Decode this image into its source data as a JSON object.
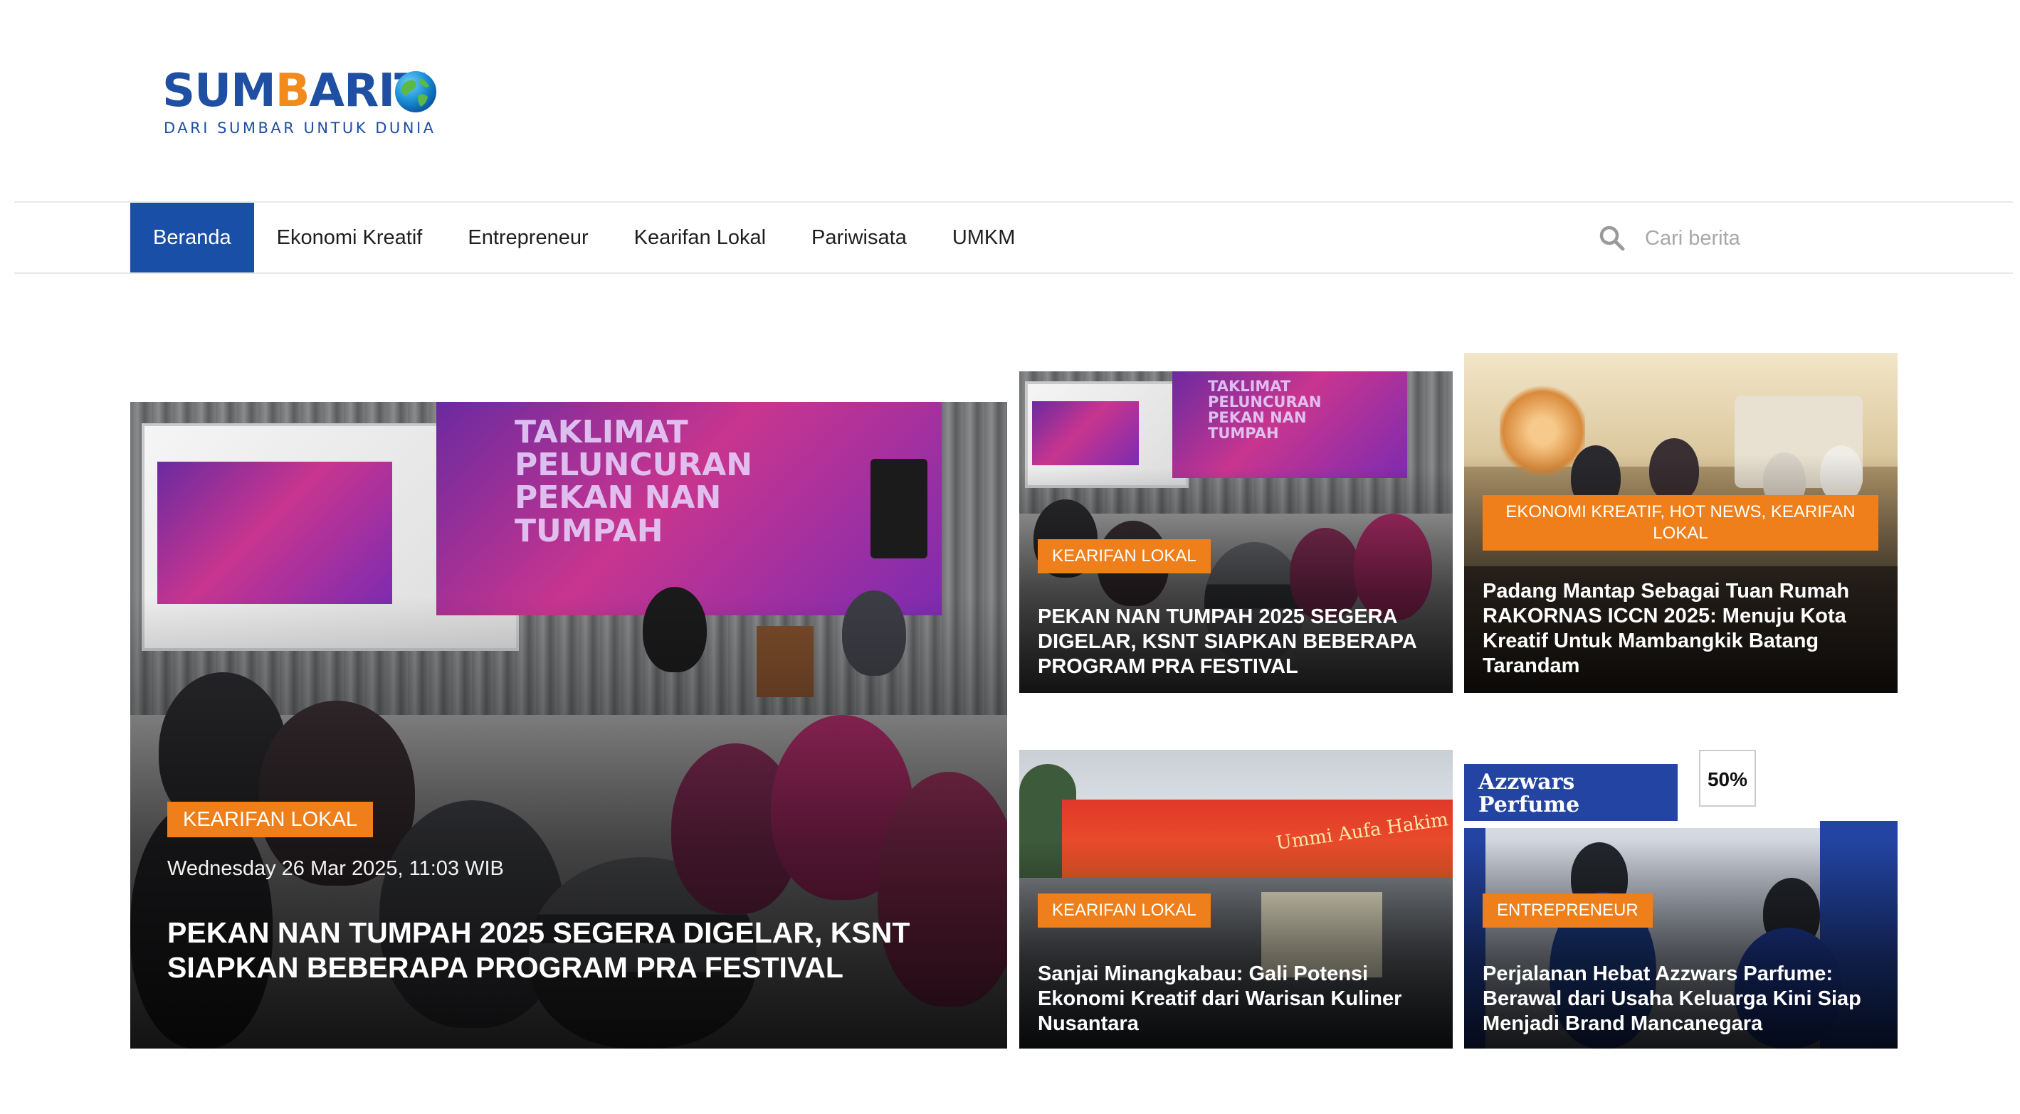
{
  "site": {
    "logo_word_part1": "SUM",
    "logo_word_part2": "B",
    "logo_word_part3": "ARIT",
    "tagline": "DARI SUMBAR UNTUK DUNIA"
  },
  "nav": {
    "items": [
      {
        "label": "Beranda",
        "active": true
      },
      {
        "label": "Ekonomi Kreatif",
        "active": false
      },
      {
        "label": "Entrepreneur",
        "active": false
      },
      {
        "label": "Kearifan Lokal",
        "active": false
      },
      {
        "label": "Pariwisata",
        "active": false
      },
      {
        "label": "UMKM",
        "active": false
      }
    ],
    "search_placeholder": "Cari berita"
  },
  "featured": {
    "category": "KEARIFAN LOKAL",
    "date": "Wednesday 26 Mar 2025, 11:03 WIB",
    "title": "PEKAN NAN TUMPAH 2025 SEGERA DIGELAR, KSNT SIAPKAN BEBERAPA PROGRAM PRA FESTIVAL",
    "image_banner_text": "TAKLIMAT PELUNCURAN PEKAN NAN TUMPAH"
  },
  "cards": [
    {
      "category": "KEARIFAN LOKAL",
      "title": "PEKAN NAN TUMPAH 2025 SEGERA DIGELAR, KSNT SIAPKAN BEBERAPA PROGRAM PRA FESTIVAL",
      "image_banner_text": "TAKLIMAT PELUNCURAN PEKAN NAN TUMPAH"
    },
    {
      "category": "EKONOMI KREATIF, HOT NEWS, KEARIFAN LOKAL",
      "title": "Padang Mantap Sebagai Tuan Rumah RAKORNAS ICCN 2025: Menuju Kota Kreatif Untuk Mambangkik Batang Tarandam"
    },
    {
      "category": "KEARIFAN LOKAL",
      "title": "Sanjai Minangkabau: Gali Potensi Ekonomi Kreatif dari Warisan Kuliner Nusantara",
      "image_sign_text": "Ummi Aufa Hakim"
    },
    {
      "category": "ENTREPRENEUR",
      "title": "Perjalanan Hebat Azzwars Parfume: Berawal dari Usaha Keluarga Kini Siap Menjadi Brand Mancanegara",
      "image_sign_text": "Azzwars Perfume",
      "image_discount_text": "50%"
    }
  ],
  "colors": {
    "brand_blue": "#1a4fa8",
    "accent_orange": "#ef7f1a"
  }
}
